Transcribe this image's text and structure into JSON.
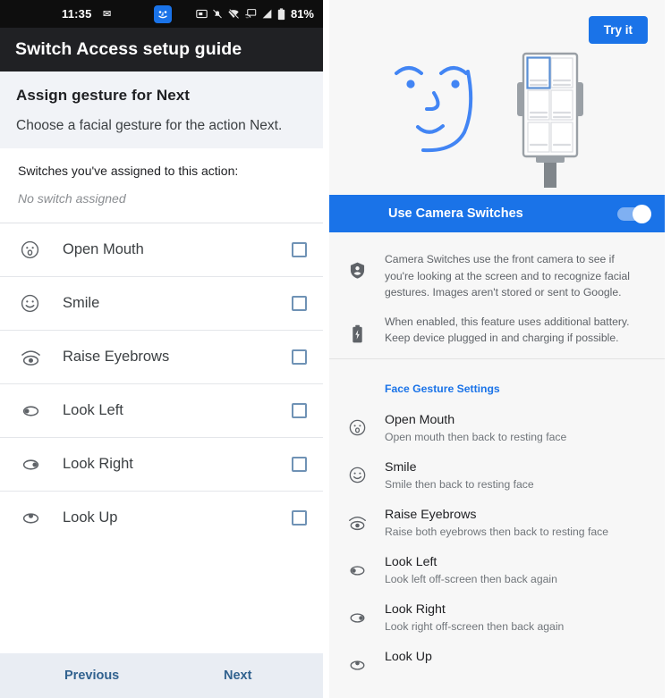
{
  "left": {
    "status_bar": {
      "time": "11:35",
      "battery_percent": "81%",
      "icons": [
        "mail-icon",
        "face-notification-icon",
        "screenshot-icon",
        "notifications-off-icon",
        "wifi-off-icon",
        "cast-icon",
        "signal-icon",
        "battery-icon"
      ]
    },
    "app_bar": {
      "title": "Switch Access setup guide"
    },
    "intro": {
      "heading": "Assign gesture for Next",
      "description": "Choose a facial gesture for the action Next."
    },
    "assigned": {
      "title": "Switches you've assigned to this action:",
      "value": "No switch assigned"
    },
    "gestures": [
      {
        "label": "Open Mouth",
        "icon": "open-mouth-icon",
        "checked": false
      },
      {
        "label": "Smile",
        "icon": "smile-icon",
        "checked": false
      },
      {
        "label": "Raise Eyebrows",
        "icon": "raise-eyebrows-icon",
        "checked": false
      },
      {
        "label": "Look Left",
        "icon": "look-left-icon",
        "checked": false
      },
      {
        "label": "Look Right",
        "icon": "look-right-icon",
        "checked": false
      },
      {
        "label": "Look Up",
        "icon": "look-up-icon",
        "checked": false
      }
    ],
    "nav": {
      "previous": "Previous",
      "next": "Next"
    }
  },
  "right": {
    "try_it_label": "Try it",
    "toggle": {
      "label": "Use Camera Switches",
      "enabled": true
    },
    "info": [
      {
        "icon": "privacy-shield-icon",
        "text": "Camera Switches use the front camera to see if you're looking at the screen and to recognize facial gestures. Images aren't stored or sent to Google."
      },
      {
        "icon": "battery-charging-icon",
        "text": "When enabled, this feature uses additional battery. Keep device plugged in and charging if possible."
      }
    ],
    "face_gesture_settings": {
      "title": "Face Gesture Settings",
      "items": [
        {
          "icon": "open-mouth-icon",
          "title": "Open Mouth",
          "subtitle": "Open mouth then back to resting face"
        },
        {
          "icon": "smile-icon",
          "title": "Smile",
          "subtitle": "Smile then back to resting face"
        },
        {
          "icon": "raise-eyebrows-icon",
          "title": "Raise Eyebrows",
          "subtitle": "Raise both eyebrows then back to resting face"
        },
        {
          "icon": "look-left-icon",
          "title": "Look Left",
          "subtitle": "Look left off-screen then back again"
        },
        {
          "icon": "look-right-icon",
          "title": "Look Right",
          "subtitle": "Look right off-screen then back again"
        },
        {
          "icon": "look-up-icon",
          "title": "Look Up",
          "subtitle": ""
        }
      ]
    }
  },
  "colors": {
    "accent_blue": "#1a73e8",
    "app_bar_dark": "#202124",
    "status_bar_black": "#0e0e0e",
    "nav_link_blue": "#31628f",
    "checkbox_border": "#6f92b5",
    "page_bg": "#f7f7f7"
  }
}
